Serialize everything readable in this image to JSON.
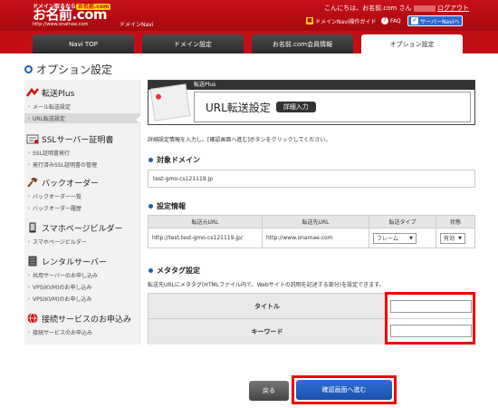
{
  "header": {
    "logo_tag_prefix": "ドメイン取るなら",
    "logo_tag_highlight": "お名前.com",
    "logo_main": "お名前.com",
    "logo_url": "http://www.onamae.com",
    "app_name": "ドメインNavi",
    "greeting_prefix": "こんにちは、お名前.com さん",
    "logout": "ログアウト",
    "buttons": {
      "guide": "ドメインNavi操作ガイド",
      "faq": "FAQ",
      "server": "サーバーNaviへ"
    }
  },
  "nav": {
    "tabs": [
      "Navi TOP",
      "ドメイン設定",
      "お名前.com会員情報",
      "オプション設定"
    ],
    "active_index": 3
  },
  "page_title": "オプション設定",
  "sidebar": {
    "sections": [
      {
        "label": "転送Plus",
        "items": [
          "メール転送設定",
          "URL転送設定"
        ]
      },
      {
        "label": "SSLサーバー証明書",
        "items": [
          "SSL証明書発行",
          "発行済みSSL証明書の管理"
        ]
      },
      {
        "label": "バックオーダー",
        "items": [
          "バックオーダー一覧",
          "バックオーダー履歴"
        ]
      },
      {
        "label": "スマホページビルダー",
        "items": [
          "スマホページビルダー"
        ]
      },
      {
        "label": "レンタルサーバー",
        "items": [
          "共用サーバーのお申し込み",
          "VPS(KVM)のお申し込み",
          "VPS(KVM)のお申し込み"
        ]
      },
      {
        "label": "接続サービスのお申込み",
        "items": [
          "接続サービスのお申込み"
        ]
      }
    ],
    "active_item": "URL転送設定"
  },
  "banner": {
    "head": "転送Plus",
    "title": "URL転送設定",
    "badge": "詳細入力"
  },
  "intro": "詳細設定情報を入力し、[確認画面へ進む]ボタンをクリックしてください。",
  "domain_section": {
    "title": "対象ドメイン",
    "value": "test-gmo-cs121119.jp"
  },
  "settings_section": {
    "title": "設定情報",
    "columns": [
      "転送元URL",
      "転送先URL",
      "転送タイプ",
      "状態"
    ],
    "row": {
      "source_url": "http://test.test-gmo-cs121119.jp/",
      "dest_url": "http://www.onamae.com",
      "type": "フレーム",
      "status": "有効"
    }
  },
  "meta_section": {
    "title": "メタタグ設定",
    "description": "転送先URLにメタタグ(HTMLファイル内で、Webサイトの説明を記述する部分)を設定できます。",
    "title_label": "タイトル",
    "keyword_label": "キーワード",
    "title_value": "",
    "keyword_value": ""
  },
  "buttons": {
    "back": "戻る",
    "confirm": "確認画面へ進む"
  },
  "colors": {
    "brand_red": "#c40e16",
    "accent_blue": "#1a5fb4",
    "highlight_red": "#ee0000"
  }
}
